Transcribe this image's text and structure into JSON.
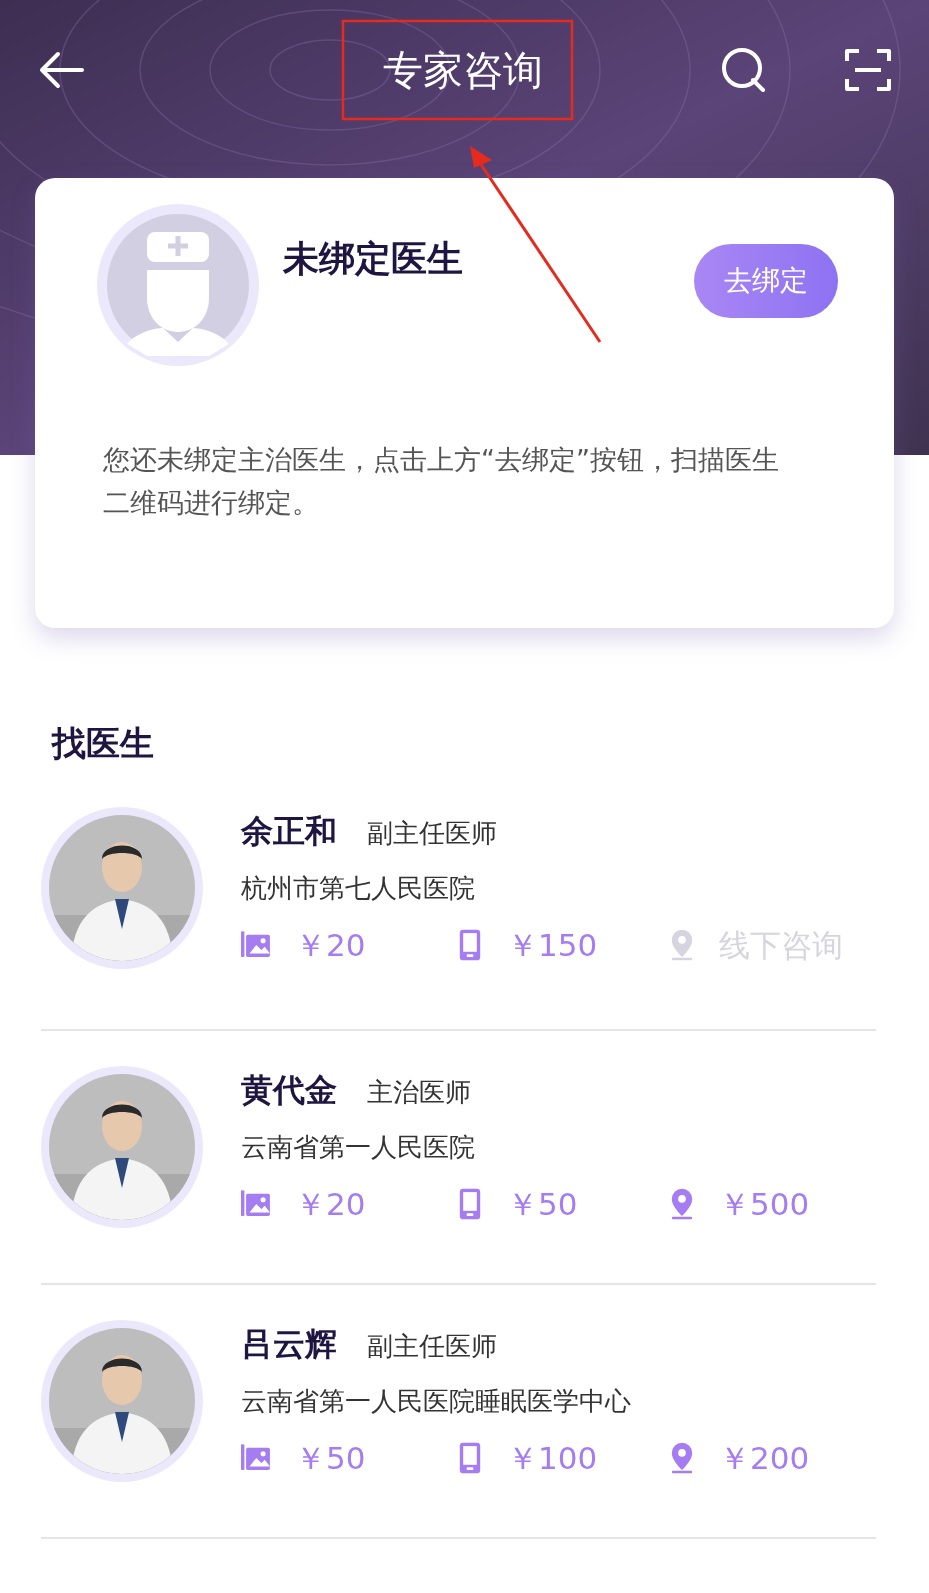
{
  "header": {
    "title": "专家咨询"
  },
  "binding_card": {
    "title": "未绑定医生",
    "button": "去绑定",
    "description": "您还未绑定主治医生，点击上方“去绑定”按钮，扫描医生二维码进行绑定。"
  },
  "section_title": "找医生",
  "doctors": [
    {
      "name": "余正和",
      "title": "副主任医师",
      "hospital": "杭州市第七人民医院",
      "services": [
        {
          "label": "￥20",
          "available": true
        },
        {
          "kind": "phone",
          "label": "￥150",
          "available": true
        },
        {
          "kind": "offline",
          "label": "线下咨询",
          "available": false
        }
      ]
    },
    {
      "name": "黄代金",
      "title": "主治医师",
      "hospital": "云南省第一人民医院",
      "services": [
        {
          "label": "￥20",
          "available": true
        },
        {
          "kind": "phone",
          "label": "￥50",
          "available": true
        },
        {
          "kind": "offline",
          "label": "￥500",
          "available": true
        }
      ]
    },
    {
      "name": "吕云辉",
      "title": "副主任医师",
      "hospital": "云南省第一人民医院睡眠医学中心",
      "services": [
        {
          "label": "￥50",
          "available": true
        },
        {
          "kind": "phone",
          "label": "￥100",
          "available": true
        },
        {
          "kind": "offline",
          "label": "￥200",
          "available": true
        }
      ]
    }
  ]
}
